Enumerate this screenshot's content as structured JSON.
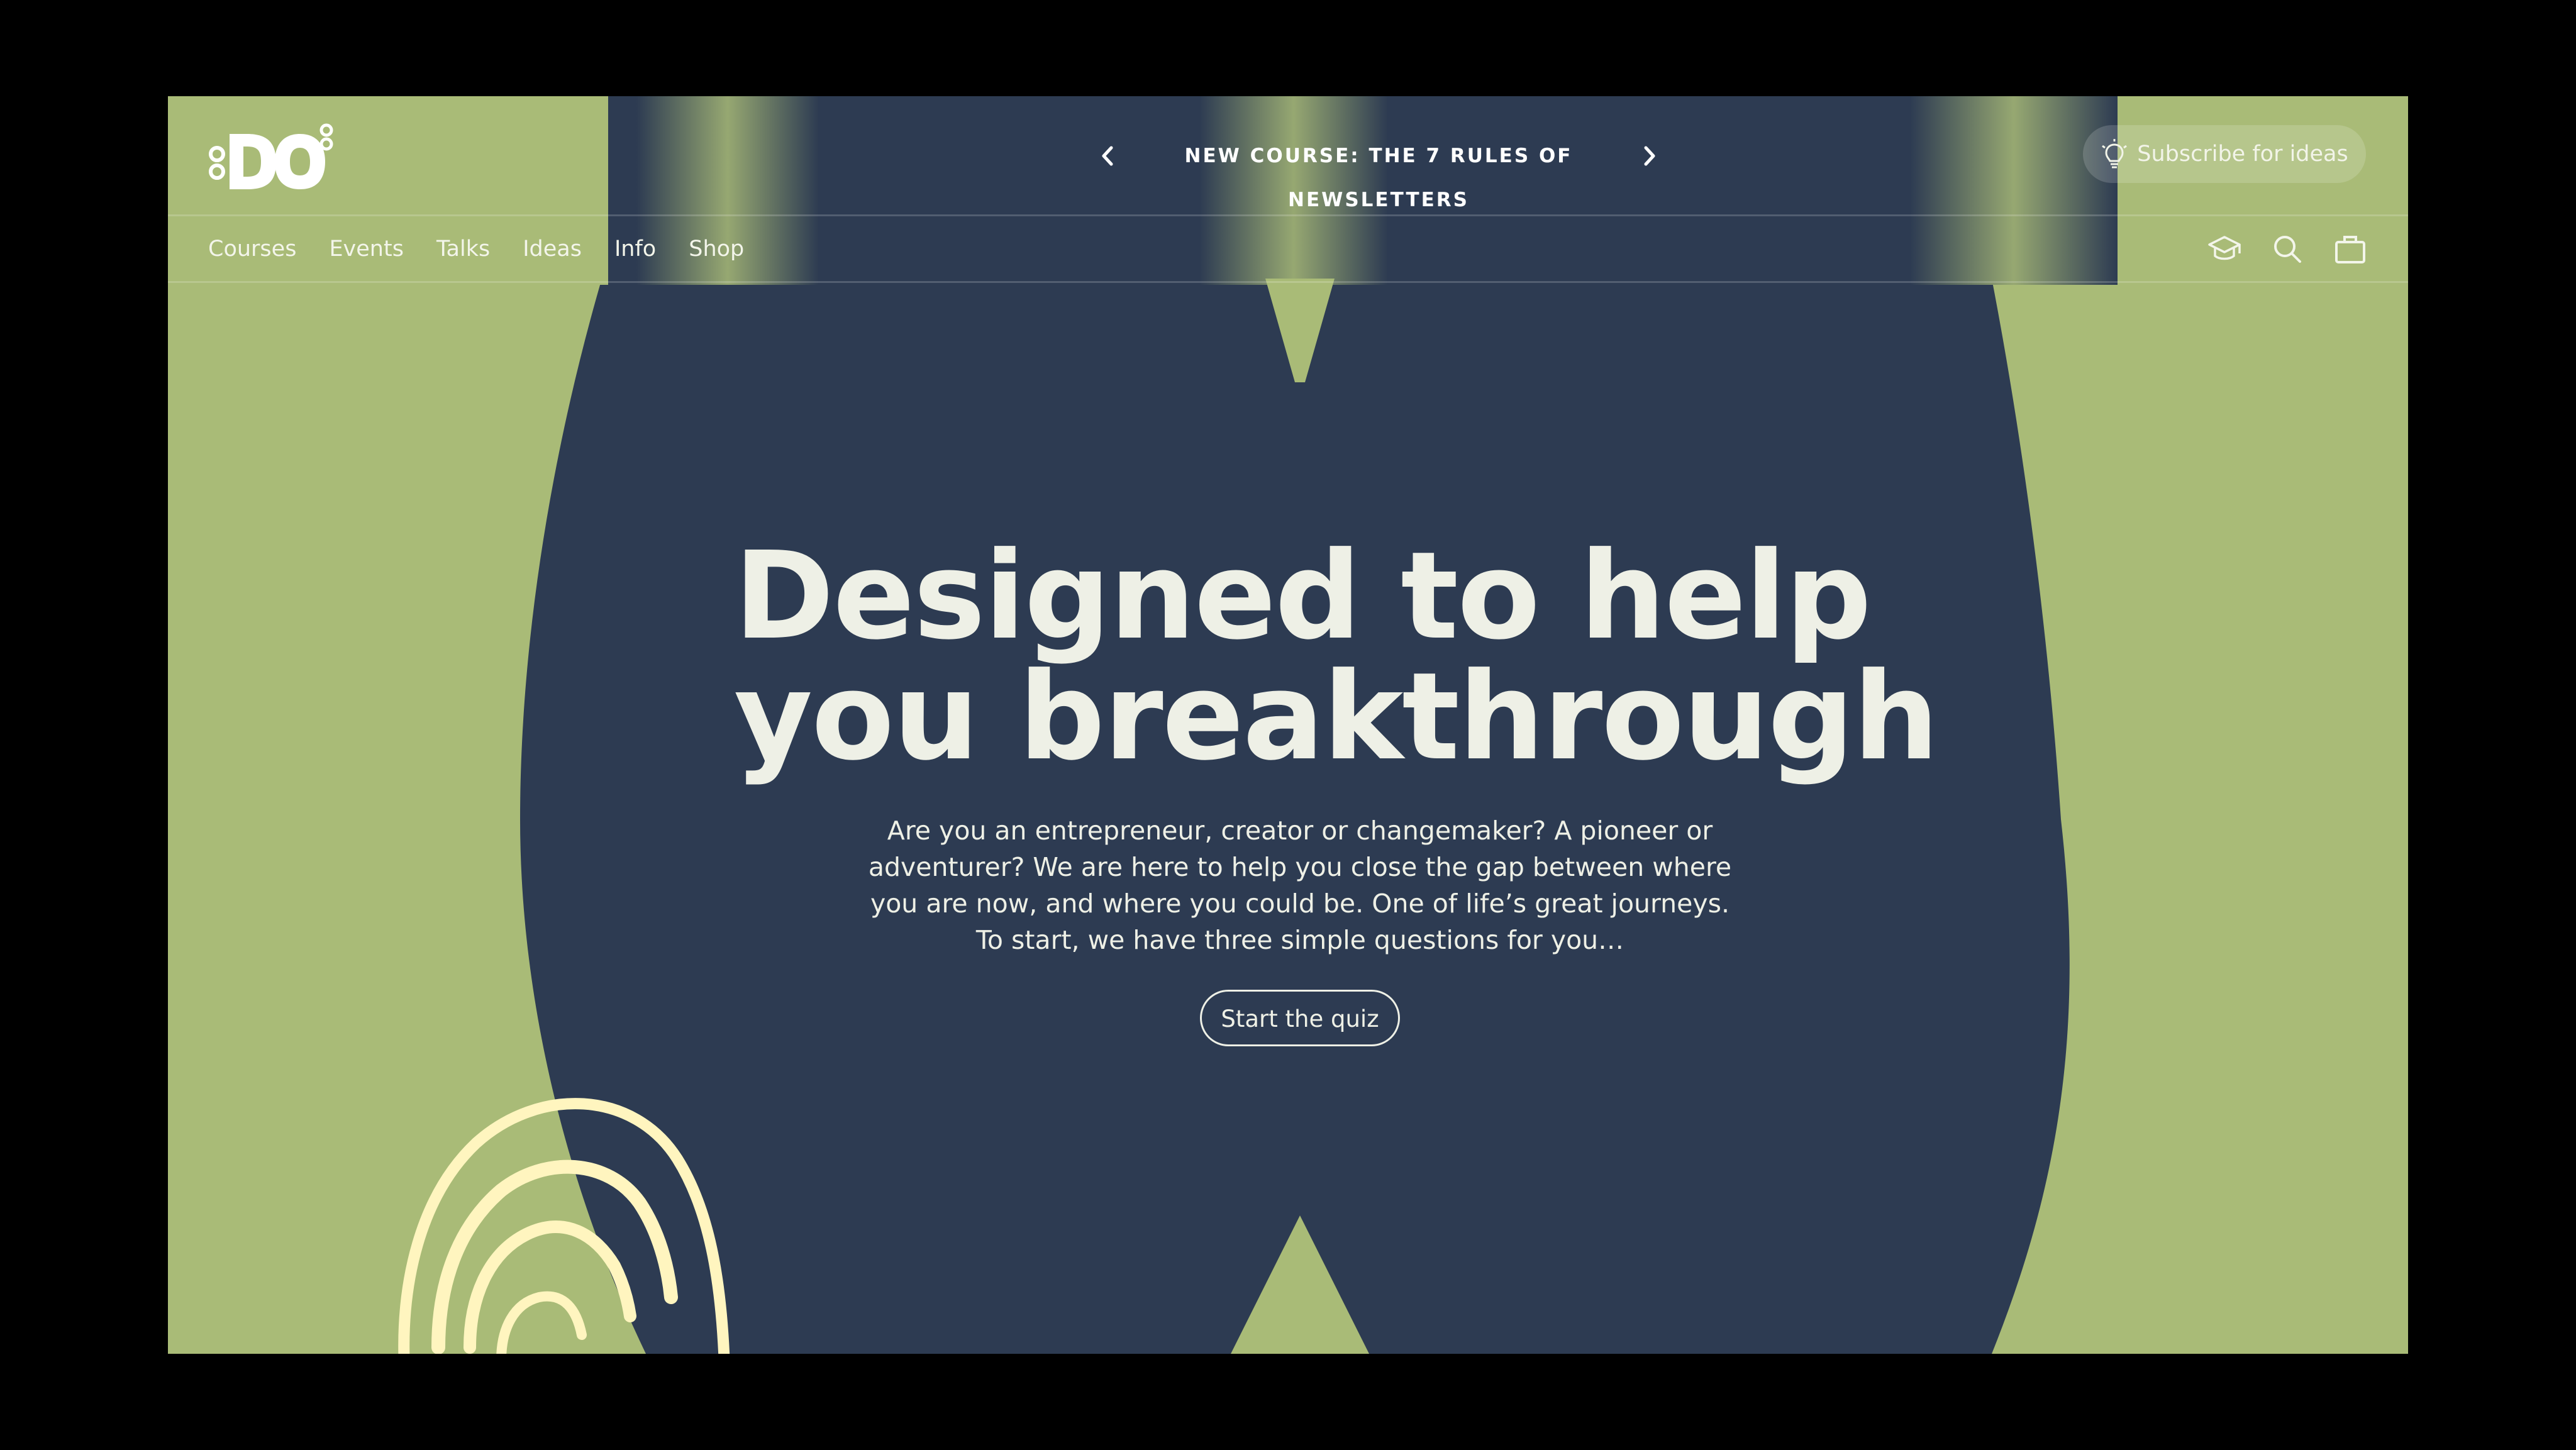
{
  "colors": {
    "page_background": "#000000",
    "green": "#a9bb77",
    "navy": "#2d3b52",
    "cream": "#fff5bf",
    "text_light": "#eef0e6"
  },
  "logo": {
    "text": "DO",
    "icon": "do-logo"
  },
  "promo": {
    "text": "NEW COURSE: THE 7 RULES OF NEWSLETTERS",
    "prev_icon": "chevron-left-icon",
    "next_icon": "chevron-right-icon"
  },
  "subscribe": {
    "label": "Subscribe for ideas",
    "icon": "lightbulb-icon"
  },
  "nav": {
    "items": [
      {
        "label": "Courses"
      },
      {
        "label": "Events"
      },
      {
        "label": "Talks"
      },
      {
        "label": "Ideas"
      },
      {
        "label": "Info"
      },
      {
        "label": "Shop"
      }
    ],
    "icons": [
      "graduation-cap-icon",
      "search-icon",
      "bag-icon"
    ]
  },
  "hero": {
    "headline_line1": "Designed to help",
    "headline_line2": "you breakthrough",
    "body": "Are you an entrepreneur, creator or changemaker? A pioneer or adventurer? We are here to help you close the gap between where you are now, and where you could be. One of life’s great journeys. To start, we have three simple questions for you…",
    "cta_label": "Start the quiz"
  }
}
